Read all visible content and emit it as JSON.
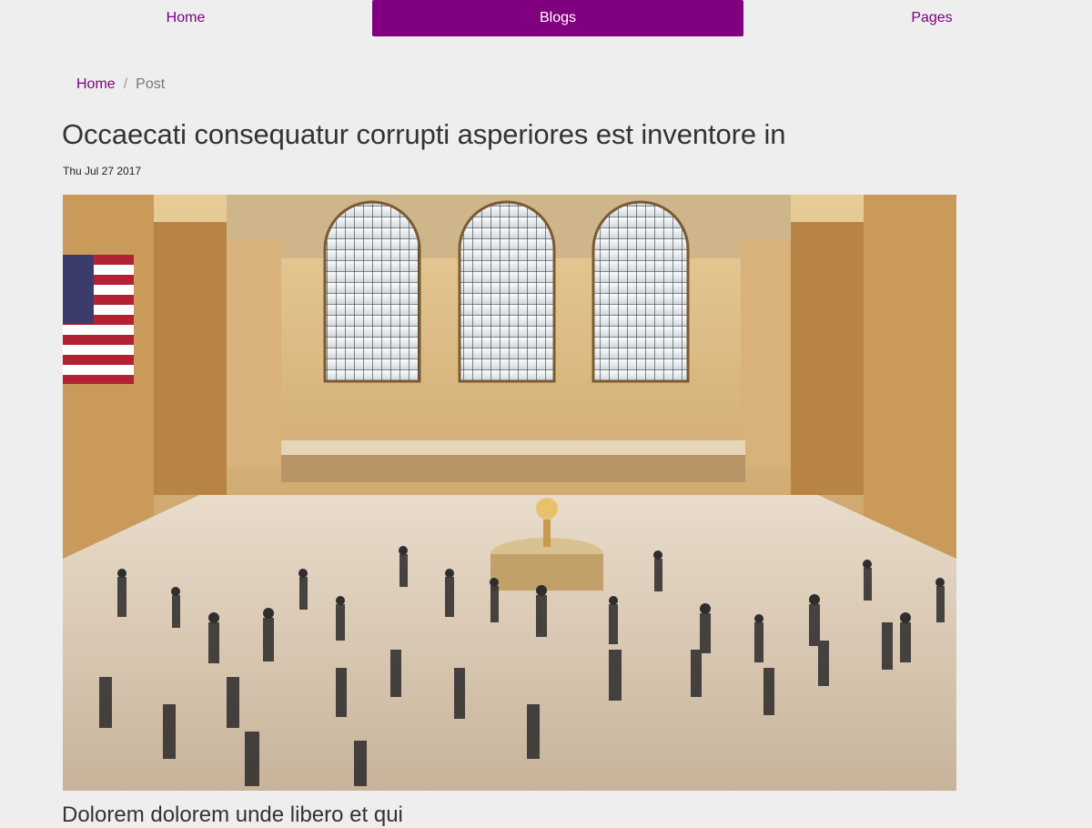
{
  "nav": {
    "home_label": "Home",
    "blogs_label": "Blogs",
    "pages_label": "Pages",
    "active": "Blogs",
    "accent_color": "#800080"
  },
  "breadcrumb": {
    "home_label": "Home",
    "separator": "/",
    "current_label": "Post"
  },
  "post": {
    "title": "Occaecati consequatur corrupti asperiores est inventore in",
    "date": "Thu Jul 27 2017",
    "image_subject": "busy-train-station-concourse-photo",
    "subheading": "Dolorem dolorem unde libero et qui"
  }
}
